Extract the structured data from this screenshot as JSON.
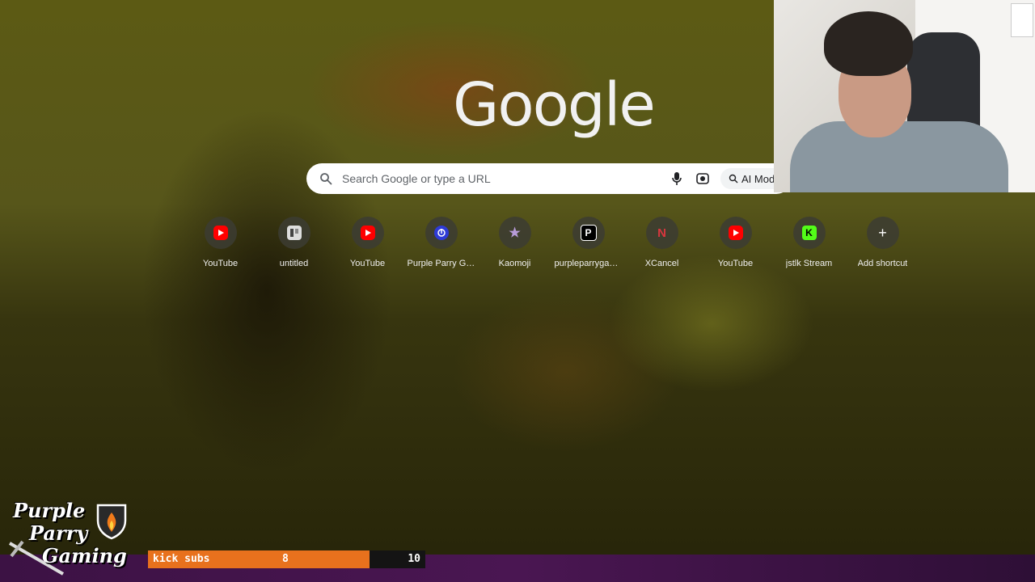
{
  "search": {
    "logo": "Google",
    "placeholder": "Search Google or type a URL",
    "ai_mode_label": "AI Mode"
  },
  "shortcuts": [
    {
      "label": "YouTube",
      "icon": "youtube-icon",
      "color": "#ff0000"
    },
    {
      "label": "untitled",
      "icon": "document-icon",
      "color": "#dddddd"
    },
    {
      "label": "YouTube",
      "icon": "youtube-icon",
      "color": "#ff0000"
    },
    {
      "label": "Purple Parry Ga...",
      "icon": "purple-parry-icon",
      "color": "#2e3bd6"
    },
    {
      "label": "Kaomoji",
      "icon": "kaomoji-icon",
      "color": "#b79bd8"
    },
    {
      "label": "purpleparrygam...",
      "icon": "p-icon",
      "color": "#000000"
    },
    {
      "label": "XCancel",
      "icon": "n-icon",
      "color": "#d9363e"
    },
    {
      "label": "YouTube",
      "icon": "youtube-icon",
      "color": "#ff0000"
    },
    {
      "label": "jstlk Stream",
      "icon": "kick-icon",
      "color": "#53fc18"
    },
    {
      "label": "Add shortcut",
      "icon": "plus-icon",
      "color": "#ffffff"
    }
  ],
  "overlay": {
    "brand_line1": "Purple",
    "brand_line2": "Parry",
    "brand_line3": "Gaming",
    "subs_label": "kick subs",
    "subs_current": "8",
    "subs_goal": "10",
    "subs_progress": 0.8,
    "subs_color": "#e8711d"
  }
}
